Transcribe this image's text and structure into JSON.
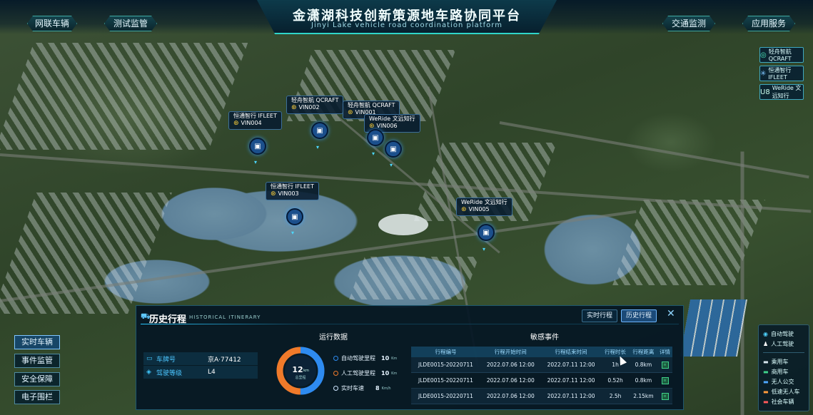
{
  "header": {
    "title": "金潇湖科技创新策源地车路协同平台",
    "subtitle": "Jinyi Lake vehicle road coordination platform",
    "left_tabs": [
      "网联车辆",
      "测试监管"
    ],
    "right_tabs": [
      "交通监测",
      "应用服务"
    ]
  },
  "brands": [
    {
      "icon": "qcraft-logo-icon",
      "text": "轻舟智航 QCRAFT"
    },
    {
      "icon": "ifleet-logo-icon",
      "text": "恒通智行 IFLEET"
    },
    {
      "icon": "weride-logo-icon",
      "text": "WeRide 文远知行"
    }
  ],
  "map_markers": [
    {
      "brand": "恒通智行 IFLEET",
      "vin": "VIN004"
    },
    {
      "brand": "轻舟智航 QCRAFT",
      "vin": "VIN002"
    },
    {
      "brand": "轻舟智航 QCRAFT",
      "vin": "VIN001"
    },
    {
      "brand": "WeRide 文远知行",
      "vin": "VIN006"
    },
    {
      "brand": "恒通智行 IFLEET",
      "vin": "VIN003"
    },
    {
      "brand": "WeRide 文远知行",
      "vin": "VIN005"
    }
  ],
  "side_menu": [
    "实时车辆",
    "事件监管",
    "安全保障",
    "电子围栏"
  ],
  "legend": {
    "drive_modes": [
      {
        "label": "自动驾驶",
        "color": "#4fd2ff"
      },
      {
        "label": "人工驾驶",
        "color": "#ffffff"
      }
    ],
    "vehicle_types": [
      {
        "label": "乘用车",
        "color": "#d8e6ef"
      },
      {
        "label": "商用车",
        "color": "#3fd28a"
      },
      {
        "label": "无人公交",
        "color": "#4fa8ff"
      },
      {
        "label": "低速无人车",
        "color": "#ff9a3c"
      },
      {
        "label": "社会车辆",
        "color": "#ff5a5a"
      }
    ]
  },
  "panel": {
    "title": "历史行程",
    "subtitle": "HISTORICAL ITINERARY",
    "tabs": [
      "实时行程",
      "历史行程"
    ],
    "active_tab": "历史行程",
    "plate_label": "车牌号",
    "plate_value": "京A·77412",
    "level_label": "驾驶等级",
    "level_value": "L4",
    "run_data_title": "运行数据",
    "donut": {
      "value": "12",
      "unit": "km",
      "label": "总里程",
      "auto_fraction": 0.5,
      "auto_color": "#2e8bf0",
      "manual_color": "#f07a2a"
    },
    "stats": [
      {
        "label": "自动驾驶里程",
        "value": "10",
        "unit": "Km",
        "color": "#2e8bf0"
      },
      {
        "label": "人工驾驶里程",
        "value": "10",
        "unit": "Km",
        "color": "#f07a2a"
      },
      {
        "label": "实时车速",
        "value": "8",
        "unit": "Km/h",
        "color": "#cfe6ff"
      }
    ],
    "events_title": "敏感事件",
    "events_headers": [
      "行程编号",
      "行程开始时间",
      "行程结束时间",
      "行程时长",
      "行程距离",
      "详情"
    ],
    "events_rows": [
      [
        "JLDE0015-20220711",
        "2022.07.06 12:00",
        "2022.07.11 12:00",
        "1h",
        "0.8km",
        "≡"
      ],
      [
        "JLDE0015-20220711",
        "2022.07.06 12:00",
        "2022.07.11 12:00",
        "0.52h",
        "0.8km",
        "≡"
      ],
      [
        "JLDE0015-20220711",
        "2022.07.06 12:00",
        "2022.07.11 12:00",
        "2.5h",
        "2.15km",
        "≡"
      ]
    ]
  }
}
